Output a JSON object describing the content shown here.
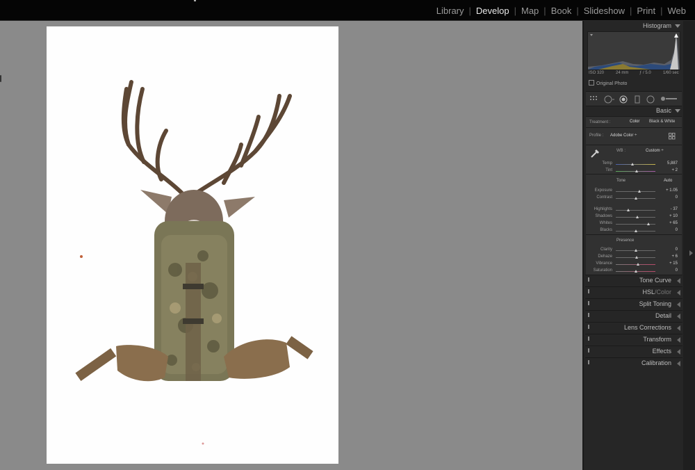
{
  "modules": {
    "library": "Library",
    "develop": "Develop",
    "map": "Map",
    "book": "Book",
    "slideshow": "Slideshow",
    "print": "Print",
    "web": "Web",
    "active": "Develop"
  },
  "histogram": {
    "title": "Histogram",
    "iso": "ISO 320",
    "focal": "24 mm",
    "aperture": "ƒ / 5.0",
    "shutter": "1/60 sec",
    "original_photo": "Original Photo"
  },
  "basic": {
    "title": "Basic",
    "treatment_label": "Treatment :",
    "treatment_color": "Color",
    "treatment_bw": "Black & White",
    "profile_label": "Profile :",
    "profile_value": "Adobe Color ÷",
    "wb_label": "WB :",
    "wb_value": "Custom ÷",
    "tone_label": "Tone",
    "auto_label": "Auto",
    "presence_label": "Presence",
    "sliders": [
      {
        "label": "Temp",
        "value": "5,887",
        "pos": 0.42
      },
      {
        "label": "Tint",
        "value": "+ 2",
        "pos": 0.52
      },
      {
        "label": "Exposure",
        "value": "+ 1.05",
        "pos": 0.6
      },
      {
        "label": "Contrast",
        "value": "0",
        "pos": 0.5
      },
      {
        "label": "Highlights",
        "value": "- 37",
        "pos": 0.32
      },
      {
        "label": "Shadows",
        "value": "+ 10",
        "pos": 0.55
      },
      {
        "label": "Whites",
        "value": "+ 65",
        "pos": 0.82
      },
      {
        "label": "Blacks",
        "value": "0",
        "pos": 0.5
      },
      {
        "label": "Clarity",
        "value": "0",
        "pos": 0.5
      },
      {
        "label": "Dehaze",
        "value": "+ 6",
        "pos": 0.53
      },
      {
        "label": "Vibrance",
        "value": "+ 15",
        "pos": 0.57
      },
      {
        "label": "Saturation",
        "value": "0",
        "pos": 0.5
      }
    ]
  },
  "sections": {
    "tone_curve": "Tone Curve",
    "hsl": "HSL",
    "hsl_color": "Color",
    "split_toning": "Split Toning",
    "detail": "Detail",
    "lens_corrections": "Lens Corrections",
    "transform": "Transform",
    "effects": "Effects",
    "calibration": "Calibration"
  },
  "colors": {
    "panel": "#262626",
    "accent_text": "#e8e8e8",
    "workspace": "#8a8a8a"
  }
}
